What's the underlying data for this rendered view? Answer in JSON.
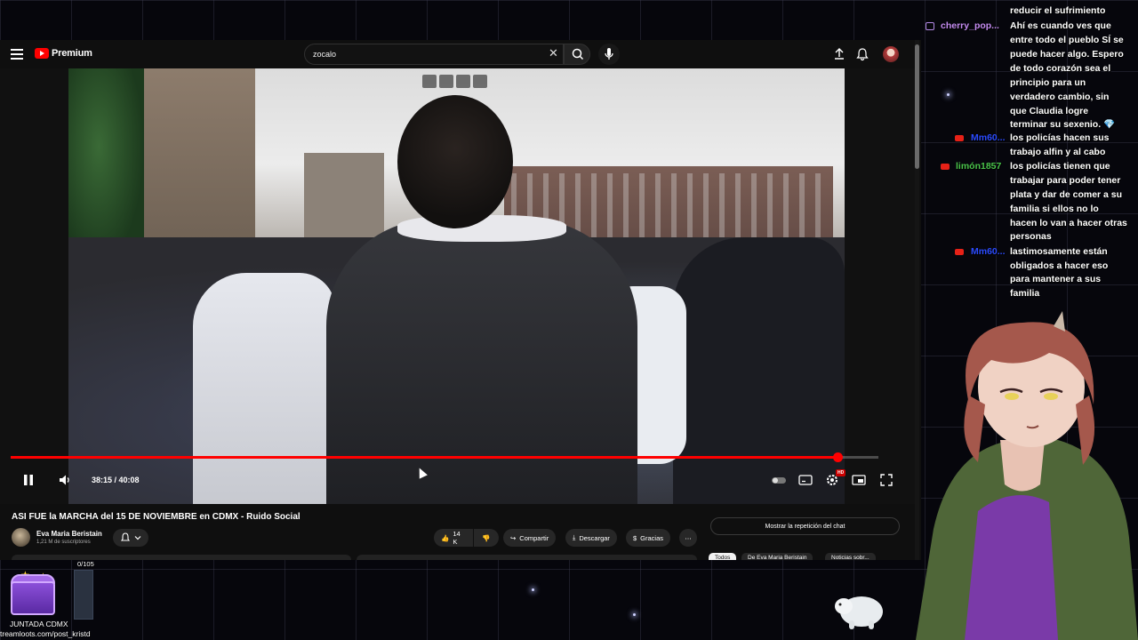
{
  "youtube": {
    "logo_text": "Premium",
    "search": {
      "value": "zocalo"
    },
    "video": {
      "title": "ASI FUE la MARCHA del 15 DE NOVIEMBRE en CDMX - Ruido Social",
      "time_display": "38:15 / 40:08",
      "progress_fraction": 0.9532,
      "quality_badge": "HD"
    },
    "channel": {
      "name": "Eva Maria Beristain",
      "subscribers": "1,21 M de suscriptores"
    },
    "actions": {
      "likes": "14 K",
      "share": "Compartir",
      "download": "Descargar",
      "thanks": "Gracias"
    },
    "chat_replay_button": "Mostrar la repetición del chat",
    "chips": [
      "Todos",
      "De Eva Maria Beristain",
      "Noticias sobr..."
    ]
  },
  "chat_overlay": {
    "top_partial": "reducir el sufrimiento",
    "messages": [
      {
        "user": "cherry_pop...",
        "platform": "twitch",
        "user_color": "#c58cf2",
        "lines": [
          "Ahí es cuando ves que",
          "entre todo el pueblo SÍ se",
          "puede hacer algo. Espero",
          "de todo corazón sea el",
          "principio para un",
          "verdadero cambio, sin",
          "que Claudia logre",
          "terminar su sexenio. 💎"
        ]
      },
      {
        "user": "Mm60...",
        "platform": "youtube",
        "user_color": "#2b4bff",
        "lines": [
          "los policías hacen sus",
          "trabajo alfin y al cabo"
        ]
      },
      {
        "user": "limón1857",
        "platform": "youtube",
        "user_color": "#49c24a",
        "lines": [
          "los policías tienen que",
          "trabajar para poder tener",
          "plata y dar de comer a su",
          "familia si ellos no lo",
          "hacen lo van a hacer otras",
          "personas"
        ]
      },
      {
        "user": "Mm60...",
        "platform": "youtube",
        "user_color": "#2b4bff",
        "lines": [
          "lastimosamente están",
          "obligados a hacer eso",
          "para mantener a sus",
          "familia"
        ]
      }
    ]
  },
  "widget": {
    "counter": "0/105",
    "label": "JUNTADA CDMX",
    "url": "treamloots.com/post_kristd"
  },
  "colors": {
    "accent": "#ff0000",
    "background": "#0f0f0f"
  }
}
